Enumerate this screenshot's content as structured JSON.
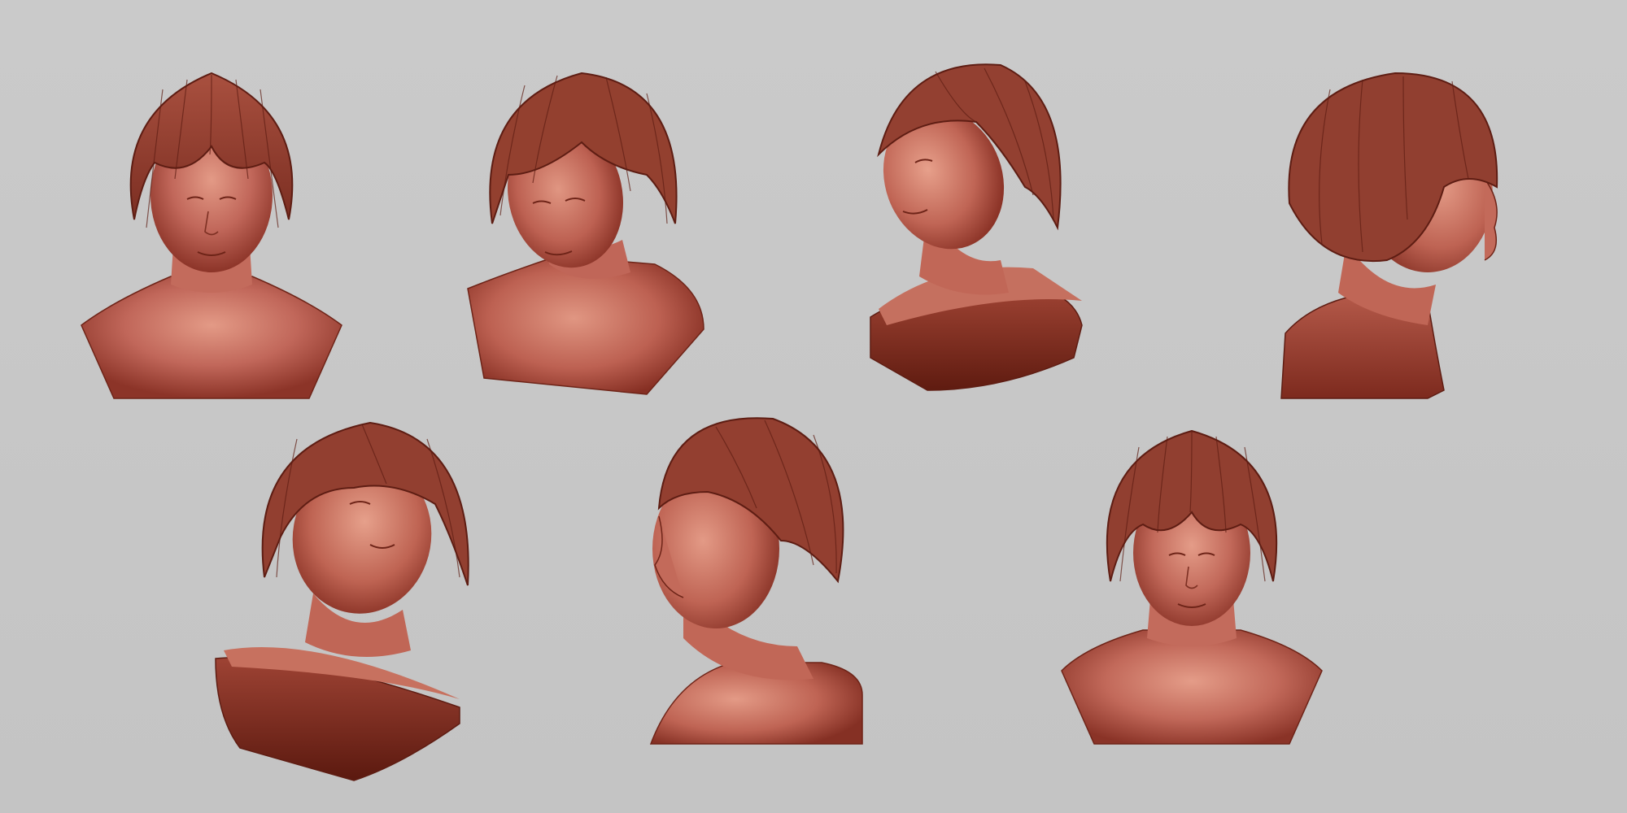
{
  "scene": {
    "background_color": "#c6c6c6",
    "material_color": "#b0584a",
    "material_shadow": "#6e2418",
    "hair_color": "#8f3e30",
    "bust_count": 7
  },
  "busts": [
    {
      "view": "front",
      "row": 1,
      "flip": false
    },
    {
      "view": "three-quarter-left-down",
      "row": 1,
      "flip": false
    },
    {
      "view": "three-quarter-left-up",
      "row": 1,
      "flip": false
    },
    {
      "view": "right-profile",
      "row": 1,
      "flip": false
    },
    {
      "view": "low-angle-tilted-up",
      "row": 2,
      "flip": false
    },
    {
      "view": "left-profile",
      "row": 2,
      "flip": true
    },
    {
      "view": "front-high-angle",
      "row": 2,
      "flip": false
    }
  ]
}
